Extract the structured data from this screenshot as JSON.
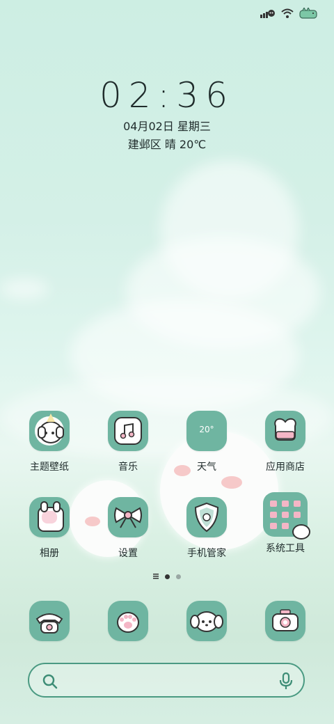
{
  "status_bar": {
    "signal_icon": "signal-bars-icon",
    "wifi_icon": "wifi-icon",
    "battery_icon": "battery-dino-icon"
  },
  "lock": {
    "time": "02:36",
    "date": "04月02日 星期三",
    "location_weather": "建邺区 晴 20℃"
  },
  "apps_row1": [
    {
      "label": "主题壁纸",
      "icon": "puppy-birthday-icon"
    },
    {
      "label": "音乐",
      "icon": "music-note-icon"
    },
    {
      "label": "天气",
      "icon": "weather-icon",
      "badge": "20°"
    },
    {
      "label": "应用商店",
      "icon": "heart-box-icon"
    }
  ],
  "apps_row2": [
    {
      "label": "相册",
      "icon": "bunny-photo-icon"
    },
    {
      "label": "设置",
      "icon": "bow-icon"
    },
    {
      "label": "手机管家",
      "icon": "shield-icon"
    },
    {
      "label": "系统工具",
      "icon": "folder-icon"
    }
  ],
  "dock": [
    {
      "icon": "phone-icon"
    },
    {
      "icon": "paw-icon"
    },
    {
      "icon": "puppy-face-icon"
    },
    {
      "icon": "camera-icon"
    }
  ],
  "pager": {
    "pages": 3,
    "current": 2
  },
  "search": {
    "search_icon": "search-icon",
    "mic_icon": "microphone-icon"
  },
  "colors": {
    "icon_bg": "#6fb5a1",
    "search_border": "#4a9a82",
    "text": "#1f2b2b"
  }
}
